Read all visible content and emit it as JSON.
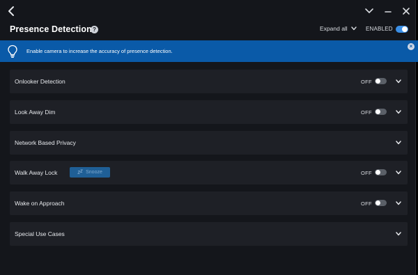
{
  "window": {
    "title": "Presence Detection",
    "help_symbol": "?",
    "controls": [
      "minimize",
      "restore",
      "close"
    ]
  },
  "header": {
    "expand_all_label": "Expand all",
    "enabled_label": "ENABLED",
    "enabled": true
  },
  "banner": {
    "text": "Enable camera to increase the accuracy of presence detection.",
    "close_symbol": "×"
  },
  "settings": [
    {
      "label": "Onlooker Detection",
      "state": "OFF",
      "has_toggle": true
    },
    {
      "label": "Look Away Dim",
      "state": "OFF",
      "has_toggle": true
    },
    {
      "label": "Network Based Privacy",
      "state": "",
      "has_toggle": false
    },
    {
      "label": "Walk Away Lock",
      "state": "OFF",
      "has_toggle": true,
      "button": "Snooze"
    },
    {
      "label": "Wake on Approach",
      "state": "OFF",
      "has_toggle": true
    },
    {
      "label": "Special Use Cases",
      "state": "",
      "has_toggle": false
    }
  ],
  "colors": {
    "background": "#14161b",
    "card": "#1e2026",
    "banner": "#0a5aa8",
    "accent": "#3b8fe6"
  }
}
